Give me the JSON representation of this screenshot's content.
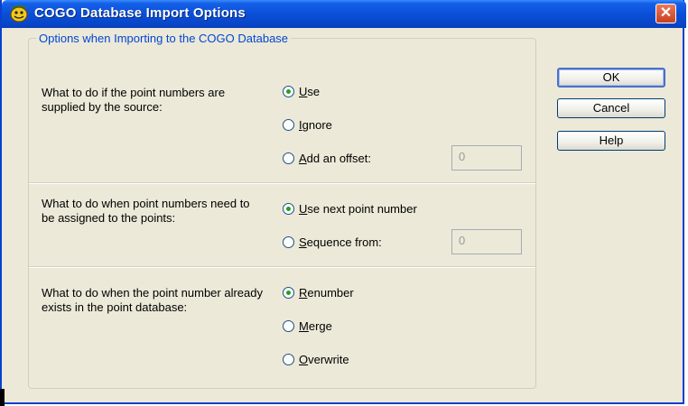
{
  "window": {
    "title": "COGO Database Import Options",
    "close_symbol": "✕"
  },
  "group": {
    "legend": "Options when Importing to the COGO Database"
  },
  "sections": [
    {
      "question": "What to do if the point numbers are supplied by the source:",
      "options": [
        {
          "label": "Use",
          "selected": true
        },
        {
          "label": "Ignore",
          "selected": false
        },
        {
          "label": "Add an offset:",
          "selected": false
        }
      ],
      "field_value": "0"
    },
    {
      "question": "What to do when point numbers need to be assigned to the points:",
      "options": [
        {
          "label": "Use next point number",
          "selected": true
        },
        {
          "label": "Sequence from:",
          "selected": false
        }
      ],
      "field_value": "0"
    },
    {
      "question": "What to do when the point number already exists in the point database:",
      "options": [
        {
          "label": "Renumber",
          "selected": true
        },
        {
          "label": "Merge",
          "selected": false
        },
        {
          "label": "Overwrite",
          "selected": false
        }
      ]
    }
  ],
  "buttons": {
    "ok": "OK",
    "cancel": "Cancel",
    "help": "Help"
  },
  "colors": {
    "titlebar": "#0a4fd8",
    "dialog_bg": "#ece9d8",
    "legend_text": "#0046d5",
    "radio_dot": "#21a121"
  }
}
